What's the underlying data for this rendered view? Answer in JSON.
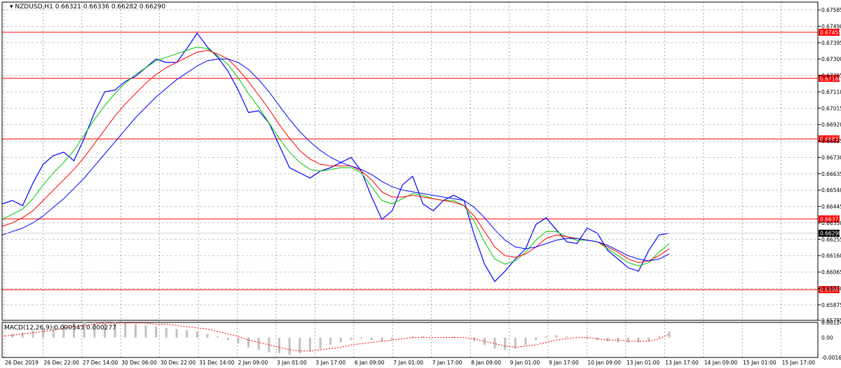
{
  "header": {
    "symbol_label": "NZDUSD,H1",
    "ohlc": "0.66321 0.66336 0.66282 0.66290"
  },
  "macd_label": "MACD(12,26,9) 0.000543 0.000277",
  "colors": {
    "price": "#0000ff",
    "ma_fast": "#00c800",
    "ma_mid": "#ff0000",
    "ma_slow": "#0000ff",
    "hline": "#ff0000",
    "grid": "#c8c8c8",
    "macd_hist": "#c0c0c0",
    "macd_signal": "#ff0000",
    "current_price_bg": "#000000"
  },
  "chart_data": {
    "type": "line",
    "ylim": [
      0.65785,
      0.6763
    ],
    "y_ticks": [
      "0.67585",
      "0.67490",
      "0.67395",
      "0.67300",
      "0.67205",
      "0.67110",
      "0.67015",
      "0.66920",
      "0.66825",
      "0.66730",
      "0.66635",
      "0.66540",
      "0.66445",
      "0.66350",
      "0.66255",
      "0.66160",
      "0.66065",
      "0.65970",
      "0.65875",
      "0.65785"
    ],
    "x_ticks": [
      "26 Dec 2019",
      "26 Dec 22:00",
      "27 Dec 14:00",
      "30 Dec 06:00",
      "30 Dec 22:00",
      "31 Dec 14:00",
      "2 Jan 09:00",
      "3 Jan 01:00",
      "3 Jan 17:00",
      "6 Jan 09:00",
      "7 Jan 01:00",
      "7 Jan 17:00",
      "8 Jan 09:00",
      "9 Jan 01:00",
      "9 Jan 17:00",
      "10 Jan 09:00",
      "13 Jan 01:00",
      "13 Jan 17:00",
      "14 Jan 09:00",
      "15 Jan 01:00",
      "15 Jan 17:00"
    ],
    "horizontal_levels": [
      {
        "value": 0.67455,
        "label": "0.67455"
      },
      {
        "value": 0.67188,
        "label": "0.67188"
      },
      {
        "value": 0.66837,
        "label": "0.66837"
      },
      {
        "value": 0.66373,
        "label": "0.66373"
      },
      {
        "value": 0.65963,
        "label": "0.65963"
      }
    ],
    "current_price": {
      "value": 0.6629,
      "label": "0.66290"
    },
    "series": [
      {
        "key": "price",
        "values": [
          0.6646,
          0.6648,
          0.6645,
          0.6658,
          0.6669,
          0.6674,
          0.6676,
          0.6671,
          0.6684,
          0.6699,
          0.6711,
          0.6712,
          0.6717,
          0.672,
          0.6725,
          0.673,
          0.6728,
          0.6728,
          0.6736,
          0.6745,
          0.6737,
          0.6731,
          0.6723,
          0.6712,
          0.6699,
          0.67,
          0.6693,
          0.668,
          0.6667,
          0.6664,
          0.6661,
          0.6665,
          0.6667,
          0.667,
          0.6673,
          0.6665,
          0.665,
          0.6637,
          0.6642,
          0.6657,
          0.6662,
          0.6646,
          0.6642,
          0.6648,
          0.6651,
          0.6648,
          0.6628,
          0.6611,
          0.6601,
          0.6607,
          0.6614,
          0.662,
          0.6634,
          0.6638,
          0.6631,
          0.6624,
          0.6623,
          0.6632,
          0.6629,
          0.6619,
          0.6614,
          0.6609,
          0.6607,
          0.6619,
          0.6628,
          0.6629
        ]
      },
      {
        "key": "ma_fast",
        "values": [
          0.6637,
          0.664,
          0.6643,
          0.6649,
          0.6657,
          0.6664,
          0.667,
          0.6677,
          0.6686,
          0.6695,
          0.6703,
          0.671,
          0.6716,
          0.6721,
          0.6725,
          0.6729,
          0.6731,
          0.6733,
          0.6735,
          0.6737,
          0.6736,
          0.6732,
          0.6727,
          0.6719,
          0.671,
          0.6702,
          0.6693,
          0.6684,
          0.6676,
          0.667,
          0.6666,
          0.6665,
          0.6666,
          0.6667,
          0.6667,
          0.6664,
          0.6656,
          0.6648,
          0.6646,
          0.6649,
          0.6652,
          0.6651,
          0.6649,
          0.6648,
          0.6648,
          0.6645,
          0.6636,
          0.6624,
          0.6614,
          0.6611,
          0.6613,
          0.6618,
          0.6625,
          0.663,
          0.663,
          0.6627,
          0.6625,
          0.6625,
          0.6624,
          0.662,
          0.6616,
          0.6612,
          0.661,
          0.6612,
          0.6618,
          0.6623
        ]
      },
      {
        "key": "ma_mid",
        "values": [
          0.6633,
          0.6635,
          0.6638,
          0.6642,
          0.6648,
          0.6654,
          0.666,
          0.6666,
          0.6673,
          0.6681,
          0.6689,
          0.6697,
          0.6704,
          0.671,
          0.6716,
          0.6721,
          0.6725,
          0.6728,
          0.6731,
          0.6734,
          0.6735,
          0.6733,
          0.673,
          0.6724,
          0.6717,
          0.6709,
          0.6701,
          0.6692,
          0.6684,
          0.6677,
          0.6672,
          0.6669,
          0.6668,
          0.6668,
          0.6668,
          0.6665,
          0.666,
          0.6653,
          0.665,
          0.665,
          0.6651,
          0.665,
          0.6649,
          0.6648,
          0.6647,
          0.6645,
          0.6639,
          0.663,
          0.6621,
          0.6616,
          0.6615,
          0.6617,
          0.6621,
          0.6626,
          0.6628,
          0.6627,
          0.6626,
          0.6625,
          0.6624,
          0.6621,
          0.6618,
          0.6614,
          0.6612,
          0.6613,
          0.6616,
          0.662
        ]
      },
      {
        "key": "ma_slow",
        "values": [
          0.6628,
          0.663,
          0.6632,
          0.6635,
          0.6639,
          0.6644,
          0.6649,
          0.6655,
          0.6661,
          0.6668,
          0.6675,
          0.6682,
          0.6689,
          0.6696,
          0.6702,
          0.6708,
          0.6713,
          0.6718,
          0.6722,
          0.6726,
          0.6729,
          0.673,
          0.673,
          0.6728,
          0.6724,
          0.6718,
          0.6711,
          0.6703,
          0.6695,
          0.6688,
          0.6682,
          0.6677,
          0.6673,
          0.667,
          0.6668,
          0.6666,
          0.6663,
          0.6659,
          0.6656,
          0.6654,
          0.6653,
          0.6652,
          0.6651,
          0.665,
          0.6649,
          0.6648,
          0.6644,
          0.6638,
          0.6631,
          0.6625,
          0.6621,
          0.662,
          0.6621,
          0.6623,
          0.6625,
          0.6626,
          0.6626,
          0.6625,
          0.6624,
          0.6622,
          0.6619,
          0.6616,
          0.6614,
          0.6613,
          0.6614,
          0.6617
        ]
      }
    ],
    "macd": {
      "ylim": [
        -0.001638,
        0.001247
      ],
      "y_ticks": [
        "0.001247",
        "0.00",
        "-0.001638"
      ],
      "histogram": [
        0.0002,
        0.0003,
        0.0004,
        0.0006,
        0.0008,
        0.001,
        0.0011,
        0.0012,
        0.0013,
        0.0014,
        0.0014,
        0.0013,
        0.0012,
        0.0011,
        0.001,
        0.0009,
        0.0008,
        0.0007,
        0.0006,
        0.0005,
        0.0003,
        0.0001,
        -0.0002,
        -0.0005,
        -0.0008,
        -0.001,
        -0.0012,
        -0.0013,
        -0.0014,
        -0.0013,
        -0.0011,
        -0.0009,
        -0.0006,
        -0.0004,
        -0.0002,
        -0.0001,
        -0.0002,
        -0.0003,
        -0.0002,
        0.0,
        0.0001,
        0.0001,
        0.0,
        0.0,
        0.0001,
        0.0,
        -0.0003,
        -0.0006,
        -0.0009,
        -0.001,
        -0.0009,
        -0.0006,
        -0.0002,
        0.0001,
        0.0002,
        0.0001,
        0.0,
        -0.0001,
        -0.0002,
        -0.0003,
        -0.0004,
        -0.0004,
        -0.0004,
        -0.0003,
        0.0001,
        0.0005
      ],
      "signal": [
        0.0001,
        0.0002,
        0.0003,
        0.0004,
        0.0005,
        0.0006,
        0.0008,
        0.0009,
        0.001,
        0.0011,
        0.0012,
        0.0012,
        0.0012,
        0.0012,
        0.0012,
        0.0011,
        0.0011,
        0.001,
        0.0009,
        0.0008,
        0.0007,
        0.0005,
        0.0003,
        0.0001,
        -0.0002,
        -0.0004,
        -0.0006,
        -0.0008,
        -0.001,
        -0.0011,
        -0.0011,
        -0.001,
        -0.0009,
        -0.0008,
        -0.0006,
        -0.0005,
        -0.0004,
        -0.0003,
        -0.0002,
        -0.0001,
        0.0,
        0.0,
        0.0,
        0.0,
        0.0,
        0.0,
        -0.0001,
        -0.0003,
        -0.0005,
        -0.0007,
        -0.0008,
        -0.0007,
        -0.0006,
        -0.0004,
        -0.0002,
        -0.0001,
        0.0,
        0.0,
        -0.0001,
        -0.0002,
        -0.0002,
        -0.0003,
        -0.0003,
        -0.0003,
        -0.0001,
        0.0003
      ]
    }
  }
}
